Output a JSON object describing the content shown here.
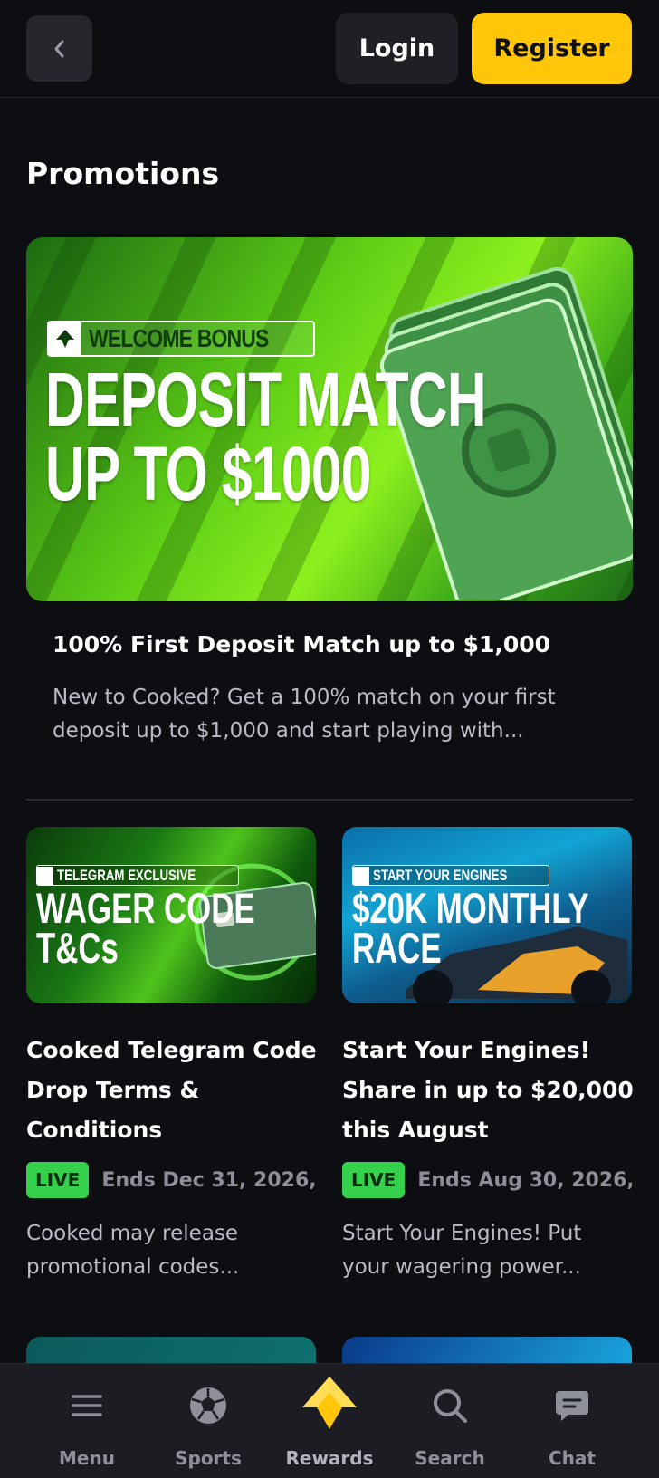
{
  "header": {
    "back_icon": "chevron-left-icon",
    "login_label": "Login",
    "register_label": "Register"
  },
  "page": {
    "title": "Promotions"
  },
  "hero": {
    "badge": "WELCOME BONUS",
    "headline_line1": "DEPOSIT MATCH",
    "headline_line2": "UP TO $1000",
    "title": "100% First Deposit Match up to $1,000",
    "description": "New to Cooked? Get a 100% match on your first deposit up to $1,000 and start playing with..."
  },
  "promos": [
    {
      "image_badge": "TELEGRAM EXCLUSIVE",
      "image_line1": "WAGER CODE",
      "image_line2": "T&Cs",
      "title": "Cooked Telegram Code Drop Terms & Conditions",
      "status": "LIVE",
      "ends": "Ends Dec 31, 2026,",
      "description": "Cooked may release promotional codes..."
    },
    {
      "image_badge": "START YOUR ENGINES",
      "image_line1": "$20K MONTHLY",
      "image_line2": "RACE",
      "title": "Start Your Engines! Share in up to $20,000 this August",
      "status": "LIVE",
      "ends": "Ends Aug 30, 2026,",
      "description": "Start Your Engines! Put your wagering power..."
    }
  ],
  "bottom_nav": [
    {
      "label": "Menu",
      "icon": "hamburger-menu-icon"
    },
    {
      "label": "Sports",
      "icon": "soccer-ball-icon"
    },
    {
      "label": "Rewards",
      "icon": "rewards-crown-icon"
    },
    {
      "label": "Search",
      "icon": "search-icon"
    },
    {
      "label": "Chat",
      "icon": "chat-bubble-icon"
    }
  ],
  "colors": {
    "background": "#0d0e12",
    "accent": "#ffc60a",
    "live": "#35d14d",
    "muted_text": "#8d9099"
  }
}
